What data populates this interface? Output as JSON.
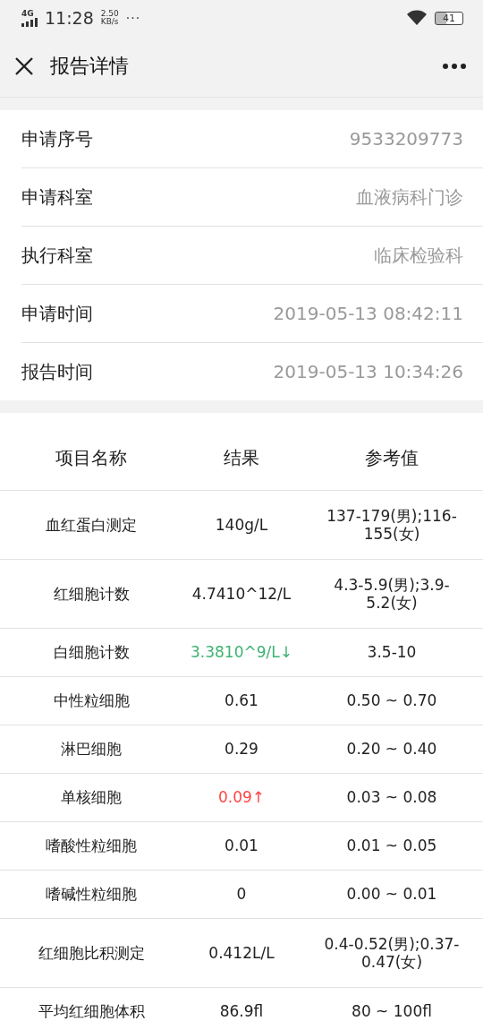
{
  "status_bar": {
    "network": "4G",
    "time": "11:28",
    "speed": "2.50",
    "speed_unit": "KB/s",
    "more": "···",
    "battery": "41"
  },
  "header": {
    "title": "报告详情"
  },
  "info": [
    {
      "label": "申请序号",
      "value": "9533209773"
    },
    {
      "label": "申请科室",
      "value": "血液病科门诊"
    },
    {
      "label": "执行科室",
      "value": "临床检验科"
    },
    {
      "label": "申请时间",
      "value": "2019-05-13 08:42:11"
    },
    {
      "label": "报告时间",
      "value": "2019-05-13 10:34:26"
    }
  ],
  "table": {
    "columns": [
      "项目名称",
      "结果",
      "参考值"
    ],
    "rows": [
      {
        "name": "血红蛋白测定",
        "result": "140g/L",
        "reference": "137-179(男);116-155(女)",
        "kind": "normal"
      },
      {
        "name": "红细胞计数",
        "result": "4.7410^12/L",
        "reference": "4.3-5.9(男);3.9-5.2(女)",
        "kind": "normal"
      },
      {
        "name": "白细胞计数",
        "result": "3.3810^9/L↓",
        "reference": "3.5-10",
        "kind": "low"
      },
      {
        "name": "中性粒细胞",
        "result": "0.61",
        "reference": "0.50 ~ 0.70",
        "kind": "normal"
      },
      {
        "name": "淋巴细胞",
        "result": "0.29",
        "reference": "0.20 ~ 0.40",
        "kind": "normal"
      },
      {
        "name": "单核细胞",
        "result": "0.09↑",
        "reference": "0.03 ~ 0.08",
        "kind": "high"
      },
      {
        "name": "嗜酸性粒细胞",
        "result": "0.01",
        "reference": "0.01 ~ 0.05",
        "kind": "normal"
      },
      {
        "name": "嗜碱性粒细胞",
        "result": "0",
        "reference": "0.00 ~ 0.01",
        "kind": "normal"
      },
      {
        "name": "红细胞比积测定",
        "result": "0.412L/L",
        "reference": "0.4-0.52(男);0.37-0.47(女)",
        "kind": "normal"
      },
      {
        "name": "平均红细胞体积",
        "result": "86.9fl",
        "reference": "80 ~ 100fl",
        "kind": "normal"
      }
    ]
  }
}
